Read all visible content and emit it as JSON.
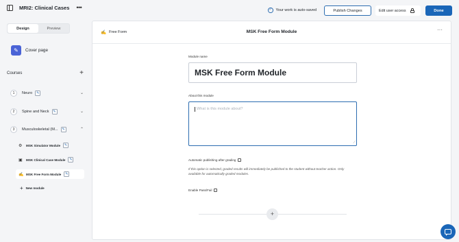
{
  "header": {
    "title": "MRI2: Clinical Cases",
    "autosave_text": "Your work is auto-saved",
    "publish_label": "Publish Changes",
    "edit_access_label": "Edit user access",
    "done_label": "Done"
  },
  "sidebar": {
    "tabs": [
      {
        "label": "Design",
        "active": true
      },
      {
        "label": "Preview",
        "active": false
      }
    ],
    "cover_label": "Cover page",
    "courses_title": "Courses",
    "courses": [
      {
        "number": "1",
        "name": "Neuro",
        "expanded": false
      },
      {
        "number": "2",
        "name": "Spine and Neck",
        "expanded": false
      },
      {
        "number": "3",
        "name": "Musculoskeletal (M...",
        "expanded": true
      }
    ],
    "modules": [
      {
        "name": "MSK Simulator Module",
        "icon": "simulator-icon"
      },
      {
        "name": "MSK Clinical Case Module",
        "icon": "clinical-case-icon"
      },
      {
        "name": "MSK Free Form Module",
        "icon": "free-form-icon",
        "active": true
      }
    ],
    "new_module_label": "New module"
  },
  "main": {
    "type_label": "Free Form",
    "title": "MSK Free Form Module",
    "module_name_label": "Module name",
    "module_name_value": "MSK Free Form Module",
    "about_label": "About this module",
    "about_placeholder": "What is this module about?",
    "auto_publish_label": "Automatic publishing after grading",
    "auto_publish_help": "If this option is selected, graded results will immediately be published to the student without teacher action. Only available for automatically graded modules.",
    "pass_fail_label": "Enable Pass/Fail"
  },
  "colors": {
    "accent": "#1a66b8",
    "cover_icon": "#4a63d6"
  }
}
